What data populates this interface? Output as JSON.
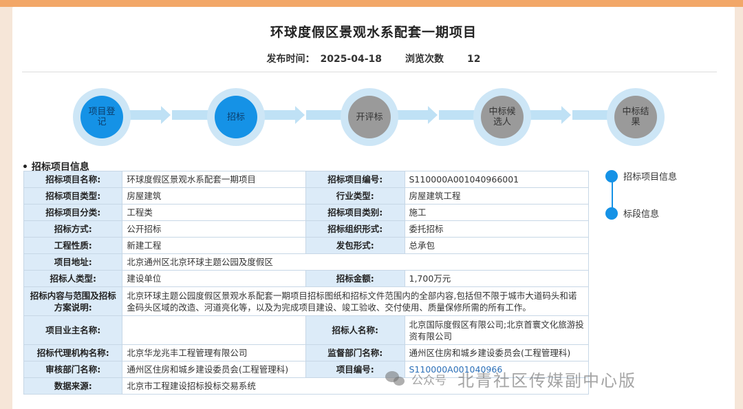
{
  "header": {
    "title": "环球度假区景观水系配套一期项目",
    "publish_label": "发布时间：",
    "publish_date": "2025-04-18",
    "views_label": "浏览次数",
    "views_count": "12"
  },
  "steps": [
    {
      "label": "项目登记",
      "state": "active"
    },
    {
      "label": "招标",
      "state": "active"
    },
    {
      "label": "开评标",
      "state": "inactive"
    },
    {
      "label": "中标候选人",
      "state": "inactive"
    },
    {
      "label": "中标结果",
      "state": "inactive"
    }
  ],
  "section": {
    "title": "• 招标项目信息"
  },
  "table": {
    "r1": {
      "k1": "招标项目名称:",
      "v1": "环球度假区景观水系配套一期项目",
      "k2": "招标项目编号:",
      "v2": "S110000A001040966001"
    },
    "r2": {
      "k1": "招标项目类型:",
      "v1": "房屋建筑",
      "k2": "行业类型:",
      "v2": "房屋建筑工程"
    },
    "r3": {
      "k1": "招标项目分类:",
      "v1": "工程类",
      "k2": "招标项目类别:",
      "v2": "施工"
    },
    "r4": {
      "k1": "招标方式:",
      "v1": "公开招标",
      "k2": "招标组织形式:",
      "v2": "委托招标"
    },
    "r5": {
      "k1": "工程性质:",
      "v1": "新建工程",
      "k2": "发包形式:",
      "v2": "总承包"
    },
    "r6": {
      "k1": "项目地址:",
      "v1": "北京通州区北京环球主题公园及度假区"
    },
    "r7": {
      "k1": "招标人类型:",
      "v1": "建设单位",
      "k2": "招标金额:",
      "v2": "1,700万元"
    },
    "r8": {
      "k1": "招标内容与范围及招标方案说明:",
      "v1": "北京环球主题公园度假区景观水系配套一期项目招标图纸和招标文件范围内的全部内容,包括但不限于城市大道码头和诺金码头区域的改造、河道亮化等，以及为完成项目建设、竣工验收、交付使用、质量保修所需的所有工作。"
    },
    "r9": {
      "k1": "项目业主名称:",
      "v1": "",
      "k2": "招标人名称:",
      "v2": "北京国际度假区有限公司;北京首寰文化旅游投资有限公司"
    },
    "r10": {
      "k1": "招标代理机构名称:",
      "v1": "北京华龙兆丰工程管理有限公司",
      "k2": "监督部门名称:",
      "v2": "通州区住房和城乡建设委员会(工程管理科)"
    },
    "r11": {
      "k1": "审核部门名称:",
      "v1": "通州区住房和城乡建设委员会(工程管理科)",
      "k2": "项目编号:",
      "v2": "S110000A001040966"
    },
    "r12": {
      "k1": "数据来源:",
      "v1": "北京市工程建设招标投标交易系统"
    }
  },
  "sidenav": {
    "items": [
      "招标项目信息",
      "标段信息"
    ]
  },
  "watermark": {
    "small": "公众号",
    "big": "北青社区传媒副中心版"
  },
  "colors": {
    "accent": "#1592e6",
    "track": "#bfe1f5",
    "header_cell": "#dcebf8",
    "topbar": "#f2a768"
  }
}
